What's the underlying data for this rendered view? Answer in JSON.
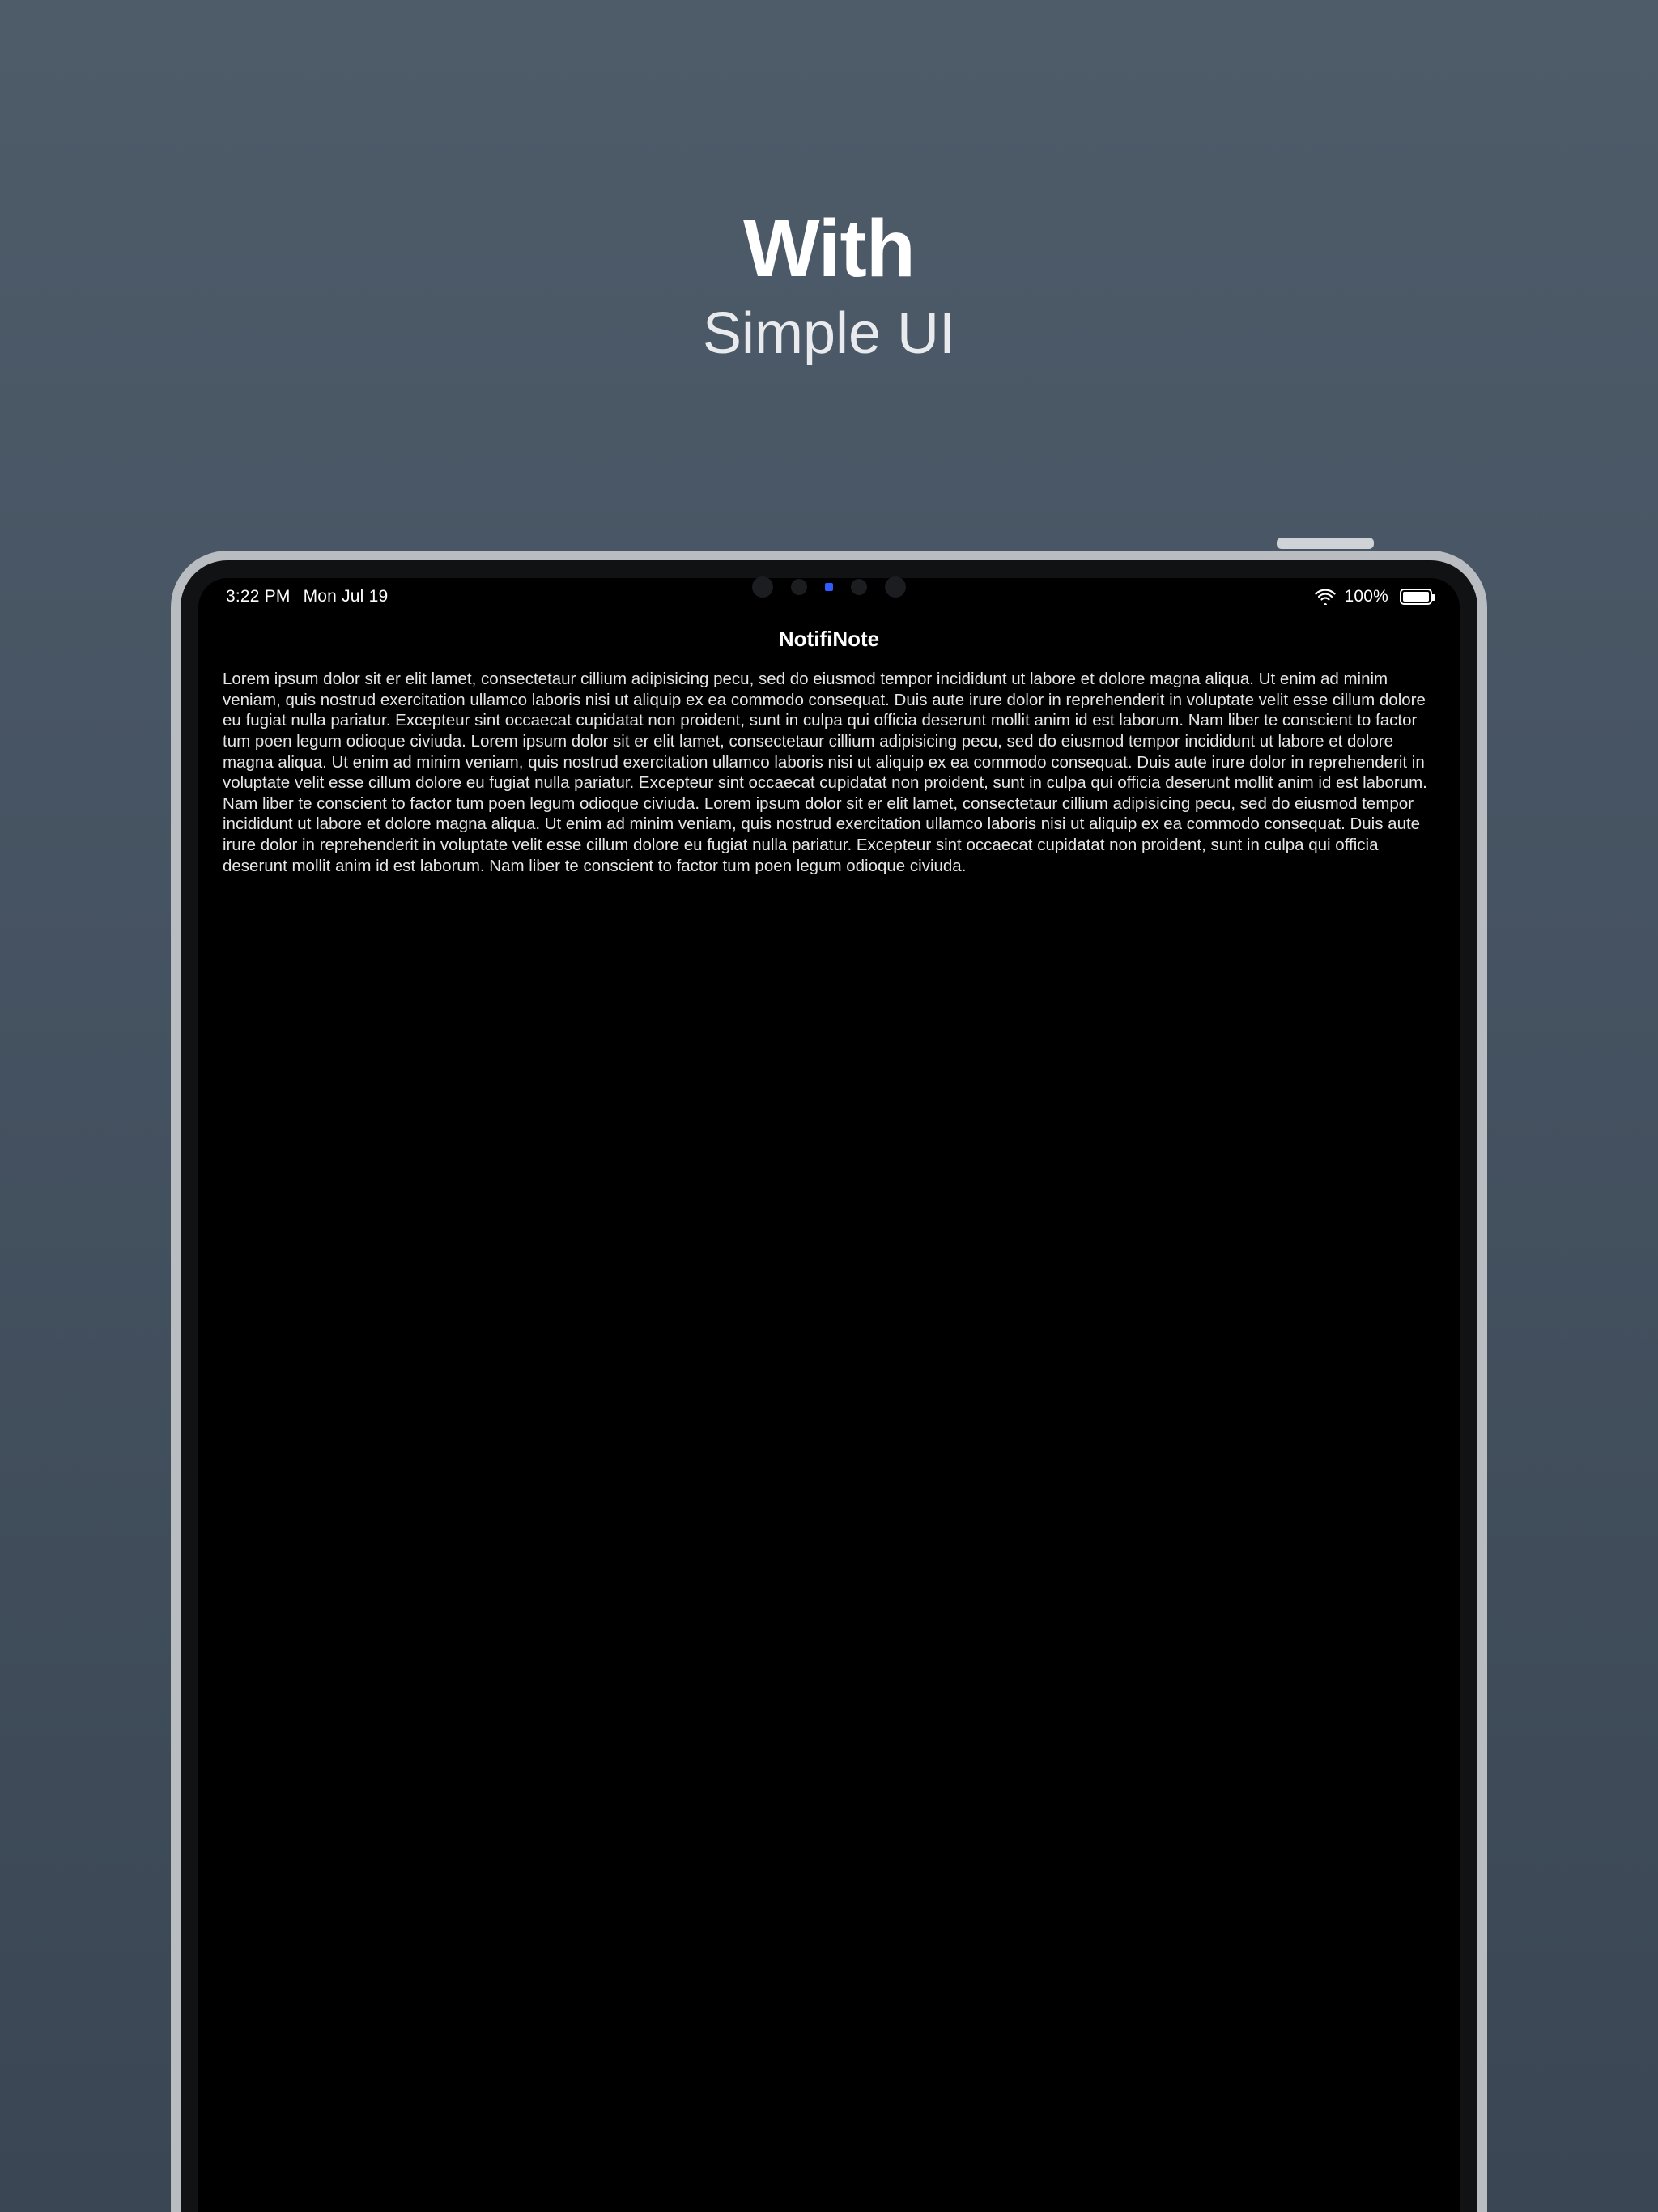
{
  "hero": {
    "title": "With",
    "subtitle": "Simple UI"
  },
  "status": {
    "time": "3:22 PM",
    "date": "Mon Jul 19",
    "battery_pct": "100%"
  },
  "app": {
    "title": "NotifiNote"
  },
  "note": {
    "body": "Lorem ipsum dolor sit er elit lamet, consectetaur cillium adipisicing pecu, sed do eiusmod tempor incididunt ut labore et dolore magna aliqua. Ut enim ad minim veniam, quis nostrud exercitation ullamco laboris nisi ut aliquip ex ea commodo consequat. Duis aute irure dolor in reprehenderit in voluptate velit esse cillum dolore eu fugiat nulla pariatur. Excepteur sint occaecat cupidatat non proident, sunt in culpa qui officia deserunt mollit anim id est laborum. Nam liber te conscient to factor tum poen legum odioque civiuda. Lorem ipsum dolor sit er elit lamet, consectetaur cillium adipisicing pecu, sed do eiusmod tempor incididunt ut labore et dolore magna aliqua. Ut enim ad minim veniam, quis nostrud exercitation ullamco laboris nisi ut aliquip ex ea commodo consequat. Duis aute irure dolor in reprehenderit in voluptate velit esse cillum dolore eu fugiat nulla pariatur. Excepteur sint occaecat cupidatat non proident, sunt in culpa qui officia deserunt mollit anim id est laborum. Nam liber te conscient to factor tum poen legum odioque civiuda. Lorem ipsum dolor sit er elit lamet, consectetaur cillium adipisicing pecu, sed do eiusmod tempor incididunt ut labore et dolore magna aliqua. Ut enim ad minim veniam, quis nostrud exercitation ullamco laboris nisi ut aliquip ex ea commodo consequat. Duis aute irure dolor in reprehenderit in voluptate velit esse cillum dolore eu fugiat nulla pariatur. Excepteur sint occaecat cupidatat non proident, sunt in culpa qui officia deserunt mollit anim id est laborum. Nam liber te conscient to factor tum poen legum odioque civiuda."
  }
}
